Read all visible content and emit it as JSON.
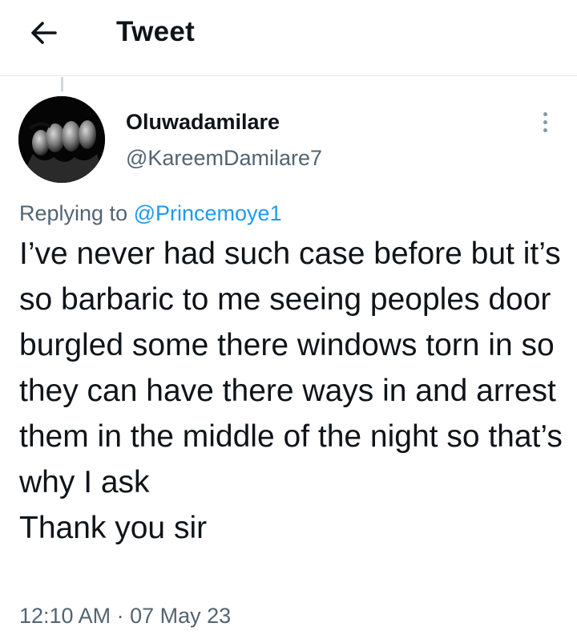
{
  "header": {
    "title": "Tweet",
    "back_icon": "arrow-left-icon"
  },
  "tweet": {
    "author": {
      "display_name": "Oluwadamilare",
      "handle": "@KareemDamilare7"
    },
    "reply": {
      "prefix": "Replying to",
      "target": "@Princemoye1"
    },
    "text": "I’ve never had such case before but it’s so barbaric to me seeing peoples door burgled some there windows torn in so they can have there ways in and arrest them in the middle of the night so that’s why I ask\nThank you sir",
    "time": "12:10 AM",
    "separator": "·",
    "date": "07 May 23"
  },
  "colors": {
    "text_primary": "#0f1419",
    "text_secondary": "#536471",
    "link": "#1d9bf0",
    "divider": "#e1e8ed"
  },
  "icons": {
    "more": "more-vertical-icon"
  }
}
